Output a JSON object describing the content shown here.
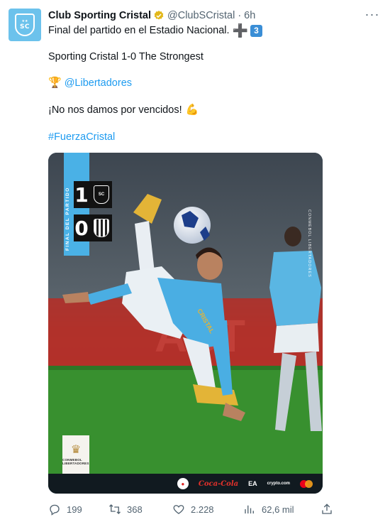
{
  "tweet": {
    "author_name": "Club Sporting Cristal",
    "handle": "@ClubSCristal",
    "separator": "·",
    "time": "6h",
    "line1": "Final del partido en el Estadio Nacional.",
    "line1_plus": "➕",
    "line1_keycap": "3",
    "line2": "Sporting Cristal 1-0 The Strongest",
    "line3_emoji": "🏆",
    "line3_link": "@Libertadores",
    "line4": "¡No nos damos por vencidos!",
    "line4_emoji": "💪",
    "hashtag": "#FuerzaCristal"
  },
  "avatar": {
    "initials": "SC"
  },
  "media": {
    "score_label": "FINAL DEL PARTIDO",
    "home_score": "1",
    "away_score": "0",
    "home_crest": "SC",
    "side_text": "CONMEBOL LIBERTADORES",
    "badge_text": "CONMEBOL LIBERTADORES",
    "sponsors": {
      "coca": "Coca-Cola",
      "ea": "EA",
      "crypto": "crypto.com"
    }
  },
  "actions": {
    "replies": "199",
    "retweets": "368",
    "likes": "2.228",
    "views": "62,6 mil"
  },
  "colors": {
    "link": "#1d9bf0",
    "muted": "#536471",
    "brand": "#4ab1e6",
    "verified": "#e2b719"
  },
  "icons": [
    "verified-badge-icon",
    "more-icon",
    "reply-icon",
    "retweet-icon",
    "like-icon",
    "views-icon",
    "share-icon"
  ]
}
